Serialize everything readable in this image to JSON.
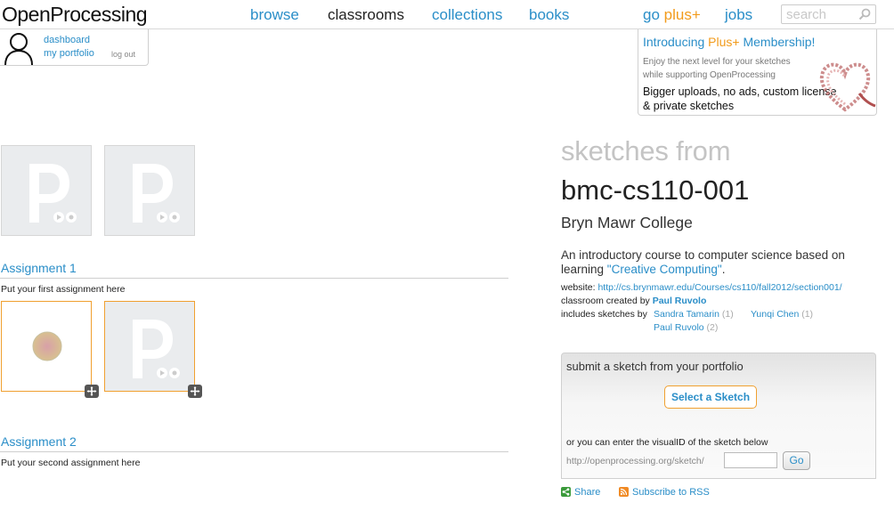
{
  "header": {
    "logo": "OpenProcessing",
    "nav": {
      "browse": "browse",
      "classrooms": "classrooms",
      "collections": "collections",
      "books": "books",
      "go": "go",
      "plus": "plus+",
      "jobs": "jobs"
    },
    "search": {
      "placeholder": "search"
    }
  },
  "user": {
    "dashboard": "dashboard",
    "portfolio": "my portfolio",
    "logout": "log out"
  },
  "plus_ad": {
    "intro": "Introducing",
    "plus": "Plus+",
    "membership": "Membership!",
    "line1": "Enjoy the next level for your sketches while supporting OpenProcessing",
    "line2": "Bigger uploads, no ads, custom license & private sketches"
  },
  "assignments": [
    {
      "title": "Assignment 1",
      "desc": "Put your first assignment here"
    },
    {
      "title": "Assignment 2",
      "desc": "Put your second assignment here"
    }
  ],
  "classroom": {
    "sketches_from": "sketches from",
    "name": "bmc-cs110-001",
    "school": "Bryn Mawr College",
    "desc_pre": "An introductory course to computer science based on learning ",
    "desc_link": "\"Creative Computing\"",
    "desc_post": ".",
    "website_label": "website:",
    "website_url": "http://cs.brynmawr.edu/Courses/cs110/fall2012/section001/",
    "created_label": "classroom created by",
    "created_by": "Paul Ruvolo",
    "includes_label": "includes sketches by",
    "authors": [
      {
        "name": "Sandra Tamarin",
        "count": "(1)"
      },
      {
        "name": "Yunqi Chen",
        "count": "(1)"
      },
      {
        "name": "Paul Ruvolo",
        "count": "(2)"
      }
    ]
  },
  "submit": {
    "heading": "submit a sketch from your portfolio",
    "select_button": "Select a Sketch",
    "or_text": "or you can enter the visualID of the sketch below",
    "url_prefix": "http://openprocessing.org/sketch/",
    "visual_id_value": "",
    "go_button": "Go"
  },
  "footer": {
    "share": "Share",
    "rss": "Subscribe to RSS"
  },
  "colors": {
    "link": "#2a8ec8",
    "accent": "#f29b1b"
  }
}
